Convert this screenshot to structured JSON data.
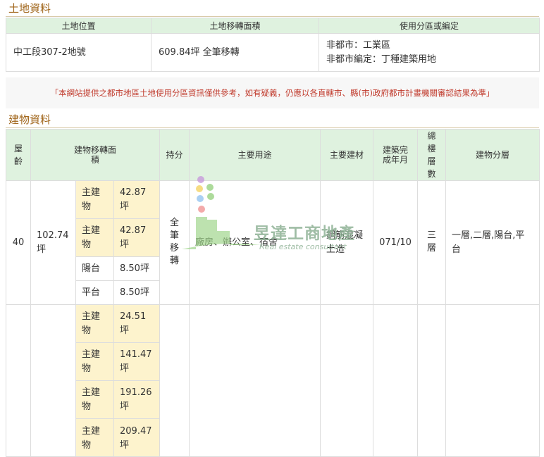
{
  "land_section": {
    "title": "土地資料",
    "headers": [
      "土地位置",
      "土地移轉面積",
      "使用分區或編定"
    ],
    "location": "中工段307-2地號",
    "area": "609.84坪 全筆移轉",
    "zoning_line1": "非都市：工業區",
    "zoning_line2": "非都市編定：丁種建築用地"
  },
  "notice": "「本網站提供之都市地區土地使用分區資訊僅供參考，如有疑義，仍應以各直轄市、縣(市)政府都市計畫機關審認結果為準」",
  "building_section": {
    "title": "建物資料",
    "headers": {
      "age": "屋齡",
      "area": "建物移轉面積",
      "share": "持分",
      "use": "主要用途",
      "material": "主要建材",
      "completed": "建築完成年月",
      "floors": "總樓層數",
      "levels": "建物分層"
    },
    "row1": {
      "age": "40",
      "total_area": "102.74坪",
      "items": [
        {
          "label": "主建物",
          "value": "42.87坪"
        },
        {
          "label": "主建物",
          "value": "42.87坪"
        },
        {
          "label": "陽台",
          "value": "8.50坪"
        },
        {
          "label": "平台",
          "value": "8.50坪"
        }
      ],
      "share": "全筆移轉",
      "use": "廠房、辦公室、宿舍",
      "material": "鋼筋混凝土造",
      "completed": "071/10",
      "floors": "三層",
      "levels": "一層,二層,陽台,平台"
    },
    "row2": {
      "items": [
        {
          "label": "主建物",
          "value": "24.51坪"
        },
        {
          "label": "主建物",
          "value": "141.47坪"
        },
        {
          "label": "主建物",
          "value": "191.26坪"
        },
        {
          "label": "主建物",
          "value": "209.47坪"
        }
      ]
    }
  },
  "watermark": {
    "name": "昱達工商地產",
    "sub": "Real estate consultant",
    "colors": {
      "purple": "#c9a0dc",
      "yellow": "#f5d76e",
      "green": "#9fd58a",
      "red": "#f19c9c",
      "blue": "#9cc8f1",
      "brand": "#8fb296"
    }
  }
}
